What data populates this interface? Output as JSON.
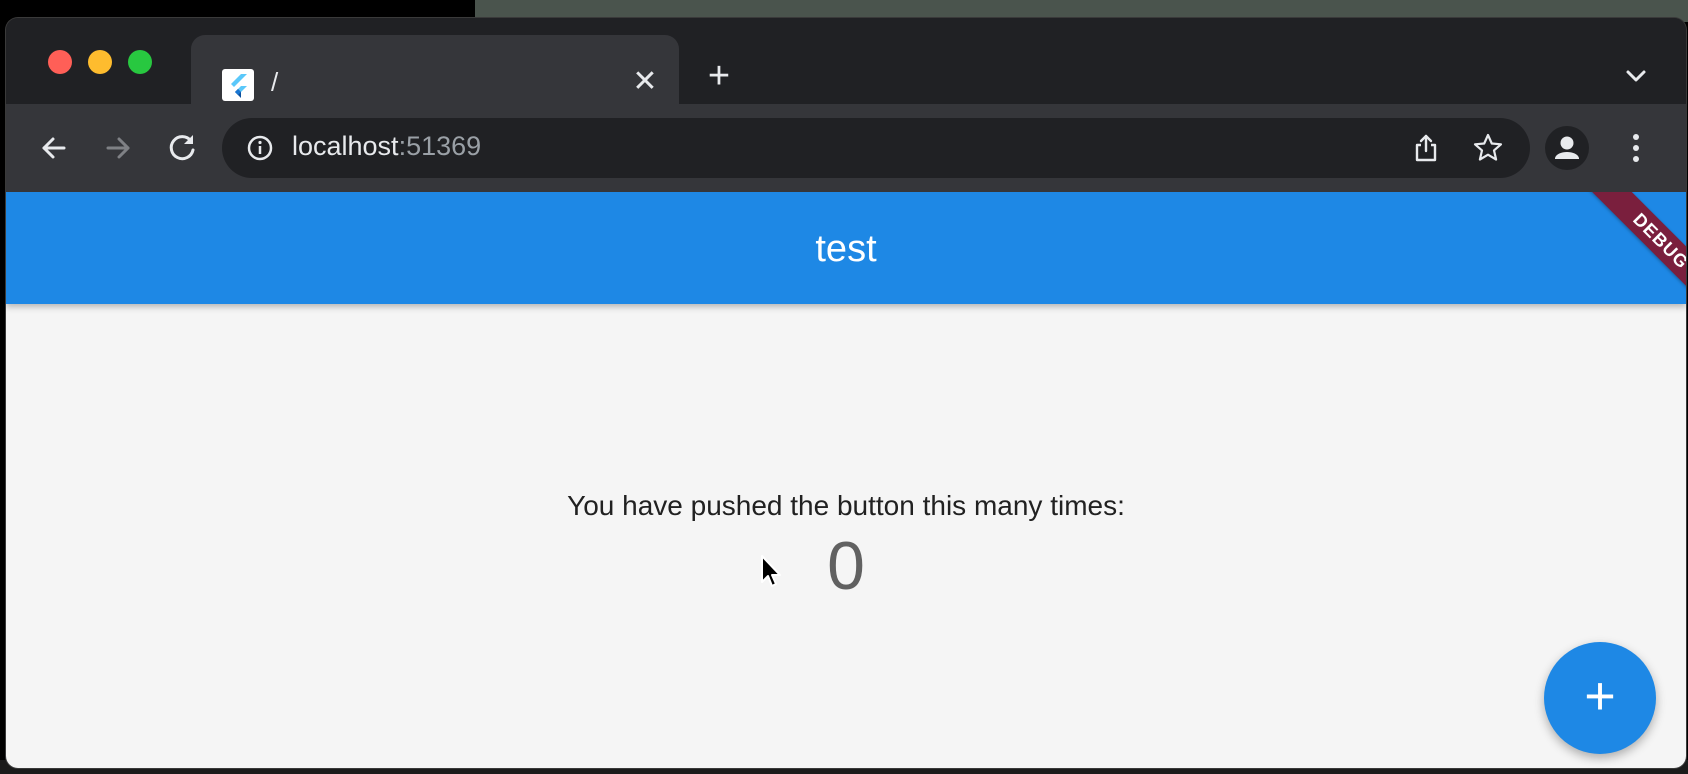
{
  "browser": {
    "tab": {
      "title": "/",
      "close_glyph": "✕",
      "favicon": "flutter-icon"
    },
    "new_tab_glyph": "+",
    "address_bar": {
      "host": "localhost",
      "port": ":51369"
    },
    "icons": {
      "back": "arrow-back-icon",
      "forward": "arrow-forward-icon",
      "reload": "reload-icon",
      "info": "info-icon",
      "share": "share-icon",
      "bookmark": "star-icon",
      "profile": "profile-icon",
      "menu": "kebab-menu-icon",
      "tab_list": "chevron-down-icon"
    },
    "colors": {
      "tabstrip": "#202124",
      "toolbar": "#35363a",
      "omnibox": "#202124"
    }
  },
  "app": {
    "appbar_title": "test",
    "debug_banner": "DEBUG",
    "counter_label": "You have pushed the button this many times:",
    "counter_value": "0",
    "fab_glyph": "+",
    "colors": {
      "primary": "#1e88e5",
      "background": "#f5f5f5",
      "debug_banner": "#7a1f3d"
    }
  }
}
